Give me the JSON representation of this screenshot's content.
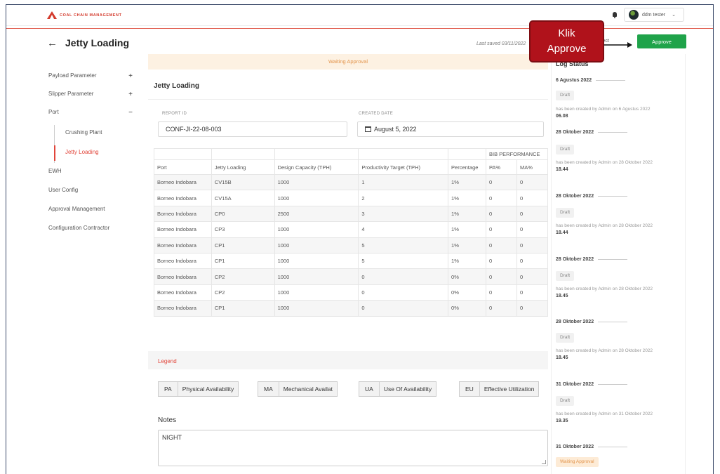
{
  "app": {
    "brand": "COAL CHAIN MANAGEMENT",
    "user_name": "ddm tester"
  },
  "header": {
    "title": "Jetty Loading",
    "last_saved": "Last saved 03/11/2022",
    "reject_label": "eject",
    "approve_label": "Approve",
    "callout_line1": "Klik",
    "callout_line2": "Approve"
  },
  "sidebar": {
    "items": [
      {
        "label": "Payload Parameter",
        "sign": "+"
      },
      {
        "label": "Slipper Parameter",
        "sign": "+"
      },
      {
        "label": "Port",
        "sign": "−"
      },
      {
        "label": "EWH"
      },
      {
        "label": "User Config"
      },
      {
        "label": "Approval Management"
      },
      {
        "label": "Configuration Contractor"
      }
    ],
    "sub_items": [
      "Crushing Plant",
      "Jetty Loading"
    ]
  },
  "main": {
    "status_banner": "Waiting Approval",
    "section_title": "Jetty Loading",
    "report_id_label": "REPORT ID",
    "report_id": "CONF-JI-22-08-003",
    "created_date_label": "CREATED DATE",
    "created_date": "August 5, 2022"
  },
  "table": {
    "group_header": "BIB PERFORMANCE",
    "headers": [
      "Port",
      "Jetty Loading",
      "Design Capacity (TPH)",
      "Productivity Target (TPH)",
      "Percentage",
      "PA%",
      "MA%"
    ],
    "rows": [
      [
        "Borneo Indobara",
        "CV15B",
        "1000",
        "1",
        "1%",
        "0",
        "0"
      ],
      [
        "Borneo Indobara",
        "CV15A",
        "1000",
        "2",
        "1%",
        "0",
        "0"
      ],
      [
        "Borneo Indobara",
        "CP0",
        "2500",
        "3",
        "1%",
        "0",
        "0"
      ],
      [
        "Borneo Indobara",
        "CP3",
        "1000",
        "4",
        "1%",
        "0",
        "0"
      ],
      [
        "Borneo Indobara",
        "CP1",
        "1000",
        "5",
        "1%",
        "0",
        "0"
      ],
      [
        "Borneo Indobara",
        "CP1",
        "1000",
        "5",
        "1%",
        "0",
        "0"
      ],
      [
        "Borneo Indobara",
        "CP2",
        "1000",
        "0",
        "0%",
        "0",
        "0"
      ],
      [
        "Borneo Indobara",
        "CP2",
        "1000",
        "0",
        "0%",
        "0",
        "0"
      ],
      [
        "Borneo Indobara",
        "CP1",
        "1000",
        "0",
        "0%",
        "0",
        "0"
      ]
    ]
  },
  "legend": {
    "title": "Legend",
    "items": [
      {
        "code": "PA",
        "name": "Physical Availability"
      },
      {
        "code": "MA",
        "name": "Mechanical Availat"
      },
      {
        "code": "UA",
        "name": "Use Of Availability"
      },
      {
        "code": "EU",
        "name": "Effective Utilization"
      }
    ]
  },
  "notes": {
    "label": "Notes",
    "value": "NIGHT"
  },
  "log": {
    "title": "Log Status",
    "entries": [
      {
        "date": "6 Agustus 2022",
        "badge": "Draft",
        "text": "has been created by Admin on 6 Agustus 2022",
        "time": "06.08"
      },
      {
        "date": "28 Oktober 2022",
        "badge": "Draft",
        "text": "has been created by Admin on 28 Oktober 2022",
        "time": "18.44"
      },
      {
        "date": "28 Oktober 2022",
        "badge": "Draft",
        "text": "has been created by Admin on 28 Oktober 2022",
        "time": "18.44"
      },
      {
        "date": "28 Oktober 2022",
        "badge": "Draft",
        "text": "has been created by Admin on 28 Oktober 2022",
        "time": "18.45"
      },
      {
        "date": "28 Oktober 2022",
        "badge": "Draft",
        "text": "has been created by Admin on 28 Oktober 2022",
        "time": "18.45"
      },
      {
        "date": "31 Oktober 2022",
        "badge": "Draft",
        "text": "has been created by Admin on 31 Oktober 2022",
        "time": "19.35"
      },
      {
        "date": "31 Oktober 2022",
        "badge": "Waiting Approval"
      }
    ]
  },
  "colors": {
    "accent": "#e1453a",
    "approve": "#1fa34a",
    "callout": "#b0121b",
    "waiting": "#e2934a"
  }
}
